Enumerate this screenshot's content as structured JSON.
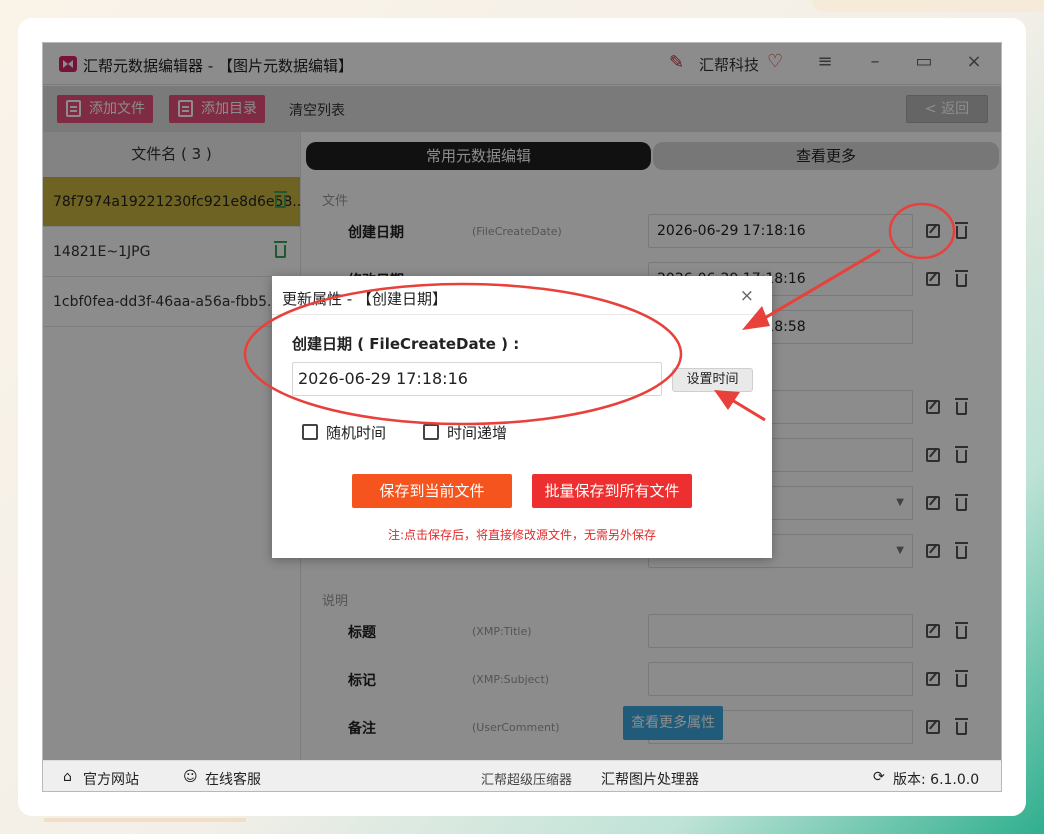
{
  "window": {
    "title": "汇帮元数据编辑器 - 【图片元数据编辑】",
    "brand": "汇帮科技"
  },
  "toolbar": {
    "add_file": "添加文件",
    "add_dir": "添加目录",
    "clear_list": "清空列表",
    "back": "< 返回"
  },
  "sidebar": {
    "header": "文件名 ( 3 )",
    "items": [
      {
        "name": "78f7974a19221230fc921e8d6e58..."
      },
      {
        "name": "14821E~1JPG"
      },
      {
        "name": "1cbf0fea-dd3f-46aa-a56a-fbb5..."
      }
    ]
  },
  "tabs": {
    "common": "常用元数据编辑",
    "more": "查看更多"
  },
  "sections": {
    "file": "文件",
    "desc": "说明"
  },
  "fields": {
    "create": {
      "label": "创建日期",
      "key": "(FileCreateDate)",
      "value": "2026-06-29 17:18:16"
    },
    "modify": {
      "label": "修改日期",
      "value": "2026-06-29 17:18:16"
    },
    "access": {
      "value": "2026-06-29 17:18:58"
    },
    "title": {
      "label": "标题",
      "key": "(XMP:Title)"
    },
    "subject": {
      "label": "标记",
      "key": "(XMP:Subject)"
    },
    "comment": {
      "label": "备注",
      "key": "(UserComment)"
    }
  },
  "more_props": "查看更多属性",
  "footer": {
    "website": "官方网站",
    "service": "在线客服",
    "compressor": "汇帮超级压缩器",
    "image_tool": "汇帮图片处理器",
    "version": "版本:  6.1.0.0"
  },
  "dialog": {
    "title": "更新属性 - 【创建日期】",
    "close": "×",
    "label": "创建日期 ( FileCreateDate ) :",
    "value": "2026-06-29 17:18:16",
    "set_time": "设置时间",
    "random_time": "随机时间",
    "increment": "时间递增",
    "save_current": "保存到当前文件",
    "save_all": "批量保存到所有文件",
    "note": "注:点击保存后，将直接修改源文件，无需另外保存"
  },
  "colors": {
    "accent_pink": "#e74f7c",
    "selected_row": "#c9b43e",
    "save_orange": "#f6541e",
    "save_red": "#ee2f2f",
    "annotation_red": "#e8403a"
  }
}
